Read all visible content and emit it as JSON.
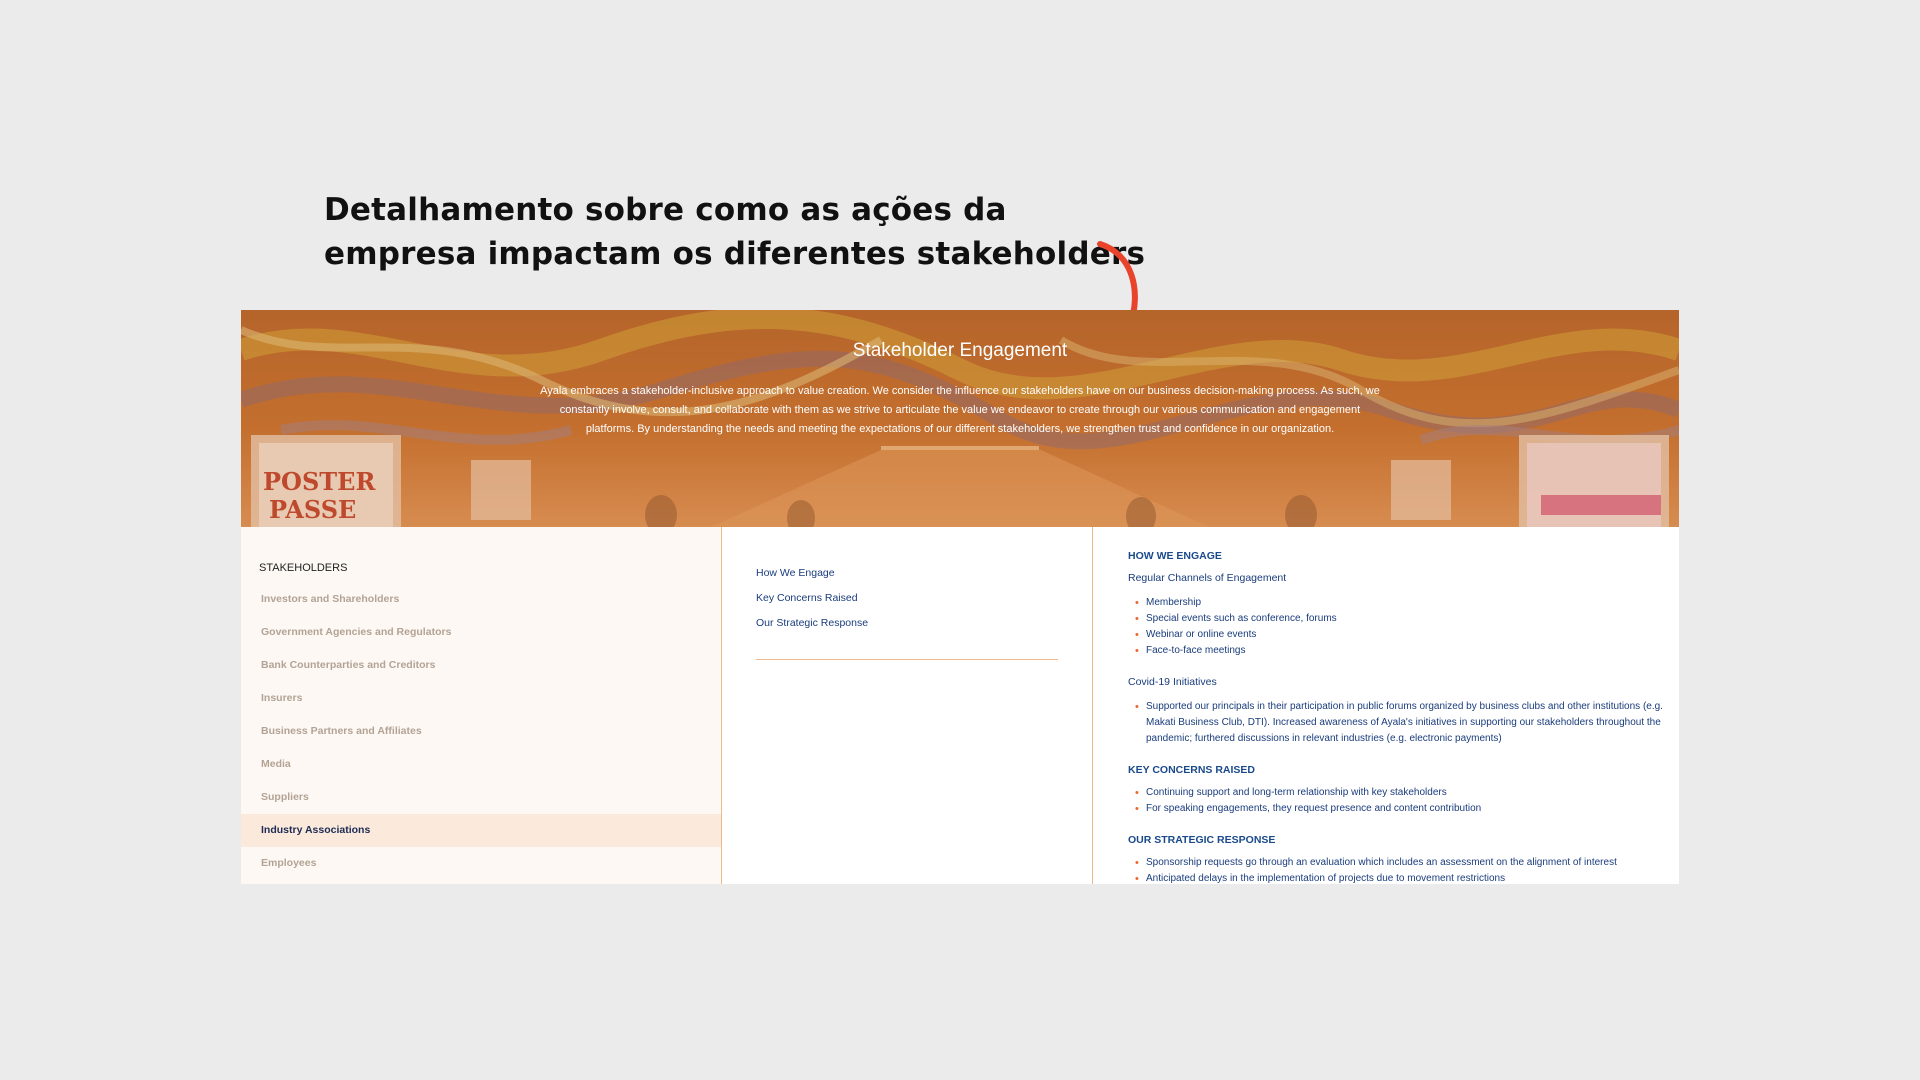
{
  "caption": {
    "line1": "Detalhamento sobre como as ações da",
    "line2": "empresa impactam os diferentes stakeholders"
  },
  "colors": {
    "background": "#ebebeb",
    "arrow": "#e8432b",
    "hero_overlay": "#c8732f",
    "nav_active": "#1d2b55",
    "link": "#1a3c7c",
    "accent_line": "#f0b98c",
    "bullet": "#e8682b"
  },
  "hero": {
    "title": "Stakeholder Engagement",
    "text": "Ayala embraces a stakeholder-inclusive approach to value creation. We consider the influence our stakeholders have on our business decision-making process. As such, we constantly involve, consult, and collaborate with them as we strive to articulate the value we endeavor to create through our various communication and engagement platforms. By understanding the needs and meeting the expectations of our different stakeholders, we strengthen trust and confidence in our organization.",
    "poster_text_1": "POSTER",
    "poster_text_2": "PASSE"
  },
  "sidebar": {
    "heading": "STAKEHOLDERS",
    "items": [
      {
        "label": "Investors and Shareholders",
        "active": false
      },
      {
        "label": "Government Agencies and Regulators",
        "active": false
      },
      {
        "label": "Bank Counterparties and Creditors",
        "active": false
      },
      {
        "label": "Insurers",
        "active": false
      },
      {
        "label": "Business Partners and Affiliates",
        "active": false
      },
      {
        "label": "Media",
        "active": false
      },
      {
        "label": "Suppliers",
        "active": false
      },
      {
        "label": "Industry Associations",
        "active": true
      },
      {
        "label": "Employees",
        "active": false
      }
    ]
  },
  "middle": {
    "links": [
      "How We Engage",
      "Key Concerns Raised",
      "Our Strategic Response"
    ]
  },
  "content": {
    "how_we_engage": {
      "heading": "HOW WE ENGAGE",
      "regular_title": "Regular Channels of Engagement",
      "regular_items": [
        "Membership",
        "Special events such as conference, forums",
        "Webinar or online events",
        "Face-to-face meetings"
      ],
      "covid_title": "Covid-19 Initiatives",
      "covid_items": [
        "Supported our principals in their participation in public forums organized by business clubs and other institutions (e.g. Makati Business Club, DTI). Increased awareness of Ayala's initiatives in supporting our stakeholders throughout the pandemic; furthered discussions in relevant industries (e.g. electronic payments)"
      ]
    },
    "key_concerns": {
      "heading": "KEY CONCERNS RAISED",
      "items": [
        "Continuing support and long-term relationship with key stakeholders",
        "For speaking engagements, they request presence and content contribution"
      ]
    },
    "strategic_response": {
      "heading": "OUR STRATEGIC RESPONSE",
      "items": [
        "Sponsorship requests go through an evaluation which includes an assessment on the alignment of interest",
        "Anticipated delays in the implementation of projects due to movement restrictions"
      ]
    }
  }
}
